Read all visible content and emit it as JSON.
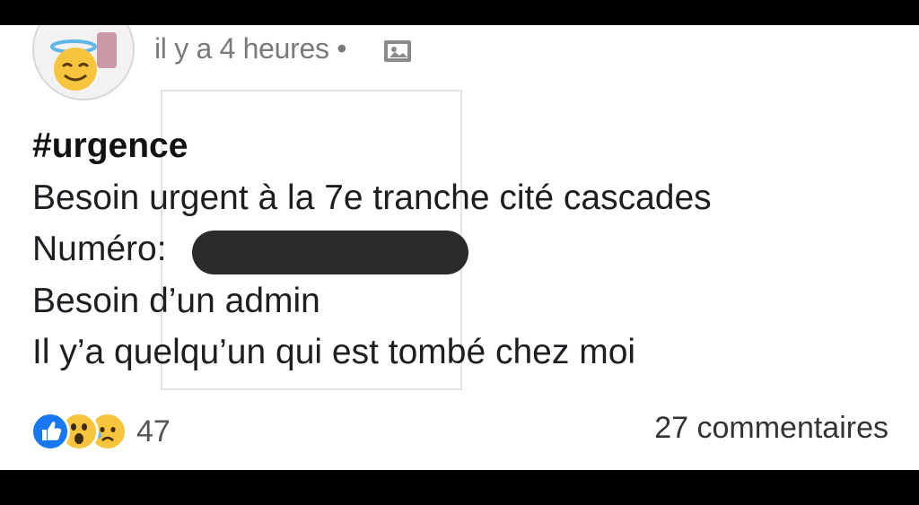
{
  "post": {
    "timestamp": "il y a 4 heures •",
    "privacy_icon": "photo-album-icon",
    "avatar_badge_icon": "smiling-face-with-halo-icon",
    "lines": {
      "hashtag": "#urgence",
      "line1": "Besoin urgent à la 7e tranche cité cascades",
      "line2": "Numéro:",
      "line3": "Besoin d’un admin",
      "line4": "Il y’a quelqu’un qui est tombé chez moi"
    }
  },
  "footer": {
    "reaction_icons": [
      "like-icon",
      "wow-icon",
      "sad-icon"
    ],
    "reaction_count": "47",
    "comments_label": "27 commentaires"
  },
  "colors": {
    "background": "#ffffff",
    "text": "#1c1e21",
    "muted": "#7a7a7a",
    "like_blue": "#1877f2",
    "emoji_yellow": "#f7c43d",
    "redaction": "#2b2b2b"
  }
}
